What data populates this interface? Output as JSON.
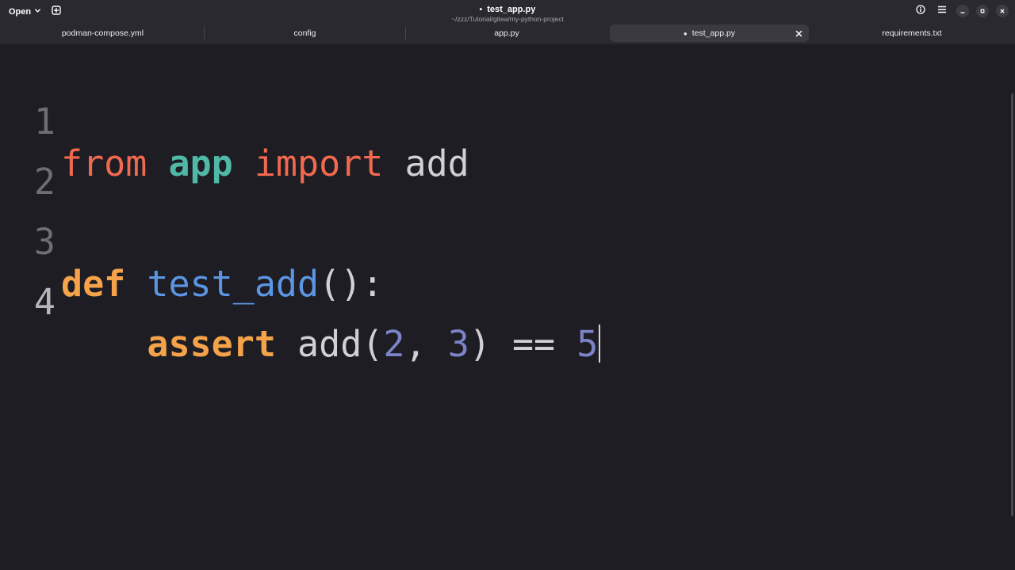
{
  "header": {
    "open_label": "Open",
    "title": "test_app.py",
    "title_modified_marker": "•",
    "subtitle": "~/zzz/Tutorial/gitea/my-python-project",
    "icons": [
      "chevron-down-icon",
      "new-tab-icon",
      "info-icon",
      "hamburger-menu-icon",
      "minimize-icon",
      "maximize-icon",
      "close-icon"
    ]
  },
  "tabs": [
    {
      "label": "podman-compose.yml",
      "active": false,
      "modified": false
    },
    {
      "label": "config",
      "active": false,
      "modified": false
    },
    {
      "label": "app.py",
      "active": false,
      "modified": false
    },
    {
      "label": "test_app.py",
      "active": true,
      "modified": true,
      "modified_marker": "●"
    },
    {
      "label": "requirements.txt",
      "active": false,
      "modified": false
    }
  ],
  "editor": {
    "lines": [
      {
        "number": "1",
        "tokens": [
          "from",
          " ",
          "app",
          " ",
          "import",
          " ",
          "add"
        ]
      },
      {
        "number": "2",
        "tokens": []
      },
      {
        "number": "3",
        "tokens": [
          "def",
          " ",
          "test_add",
          "():"
        ]
      },
      {
        "number": "4",
        "tokens": [
          "    ",
          "assert",
          " add(",
          "2",
          ", ",
          "3",
          ") == ",
          "5"
        ]
      }
    ],
    "current_line": "4"
  },
  "colors": {
    "background": "#1e1d23",
    "headerbar": "#2a292f",
    "keyword_import": "#f1694f",
    "module": "#50b8a6",
    "keyword_def": "#f5a34a",
    "function_name": "#5b95e3",
    "number": "#7b84c8",
    "plain": "#d1d0d3"
  }
}
